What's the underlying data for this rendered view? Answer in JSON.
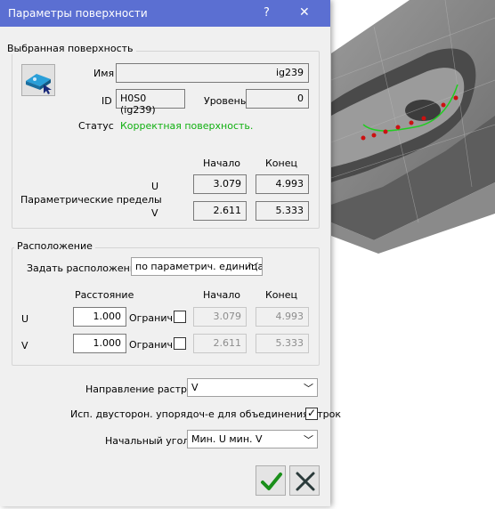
{
  "dialog": {
    "title": "Параметры поверхности",
    "help_glyph": "?",
    "close_glyph": "✕"
  },
  "selected_surface": {
    "group_title": "Выбранная поверхность",
    "name_label": "Имя",
    "name_value": "ig239",
    "id_label": "ID",
    "id_value": "H0S0 (ig239)",
    "level_label": "Уровень",
    "level_value": "0",
    "status_label": "Статус",
    "status_value": "Корректная поверхность.",
    "status_color": "#10b010"
  },
  "param_limits": {
    "label": "Параметрические пределы",
    "start_header": "Начало",
    "end_header": "Конец",
    "u_label": "U",
    "v_label": "V",
    "u_start": "3.079",
    "u_end": "4.993",
    "v_start": "2.611",
    "v_end": "5.333"
  },
  "placement": {
    "group_title": "Расположение",
    "set_label": "Задать расположение",
    "set_value": "по параметрич. единица",
    "distance_header": "Расстояние",
    "start_header": "Начало",
    "end_header": "Конец",
    "u_label": "U",
    "v_label": "V",
    "u_distance": "1.000",
    "v_distance": "1.000",
    "limit_label": "Огранич.",
    "u_limit_checked": false,
    "v_limit_checked": false,
    "u_start": "3.079",
    "u_end": "4.993",
    "v_start": "2.611",
    "v_end": "5.333"
  },
  "raster": {
    "direction_label": "Направление растра",
    "direction_value": "V",
    "two_sided_label": "Исп. двусторон. упорядоч-е для объединения строк",
    "two_sided_checked": true,
    "start_angle_label": "Начальный угол",
    "start_angle_value": "Мин. U мин. V"
  },
  "buttons": {
    "ok_icon": "checkmark-icon",
    "cancel_icon": "cross-icon"
  },
  "colors": {
    "titlebar": "#5b6fd2",
    "accept_green": "#1a8f1a",
    "cancel_dark": "#2a3a3a"
  }
}
